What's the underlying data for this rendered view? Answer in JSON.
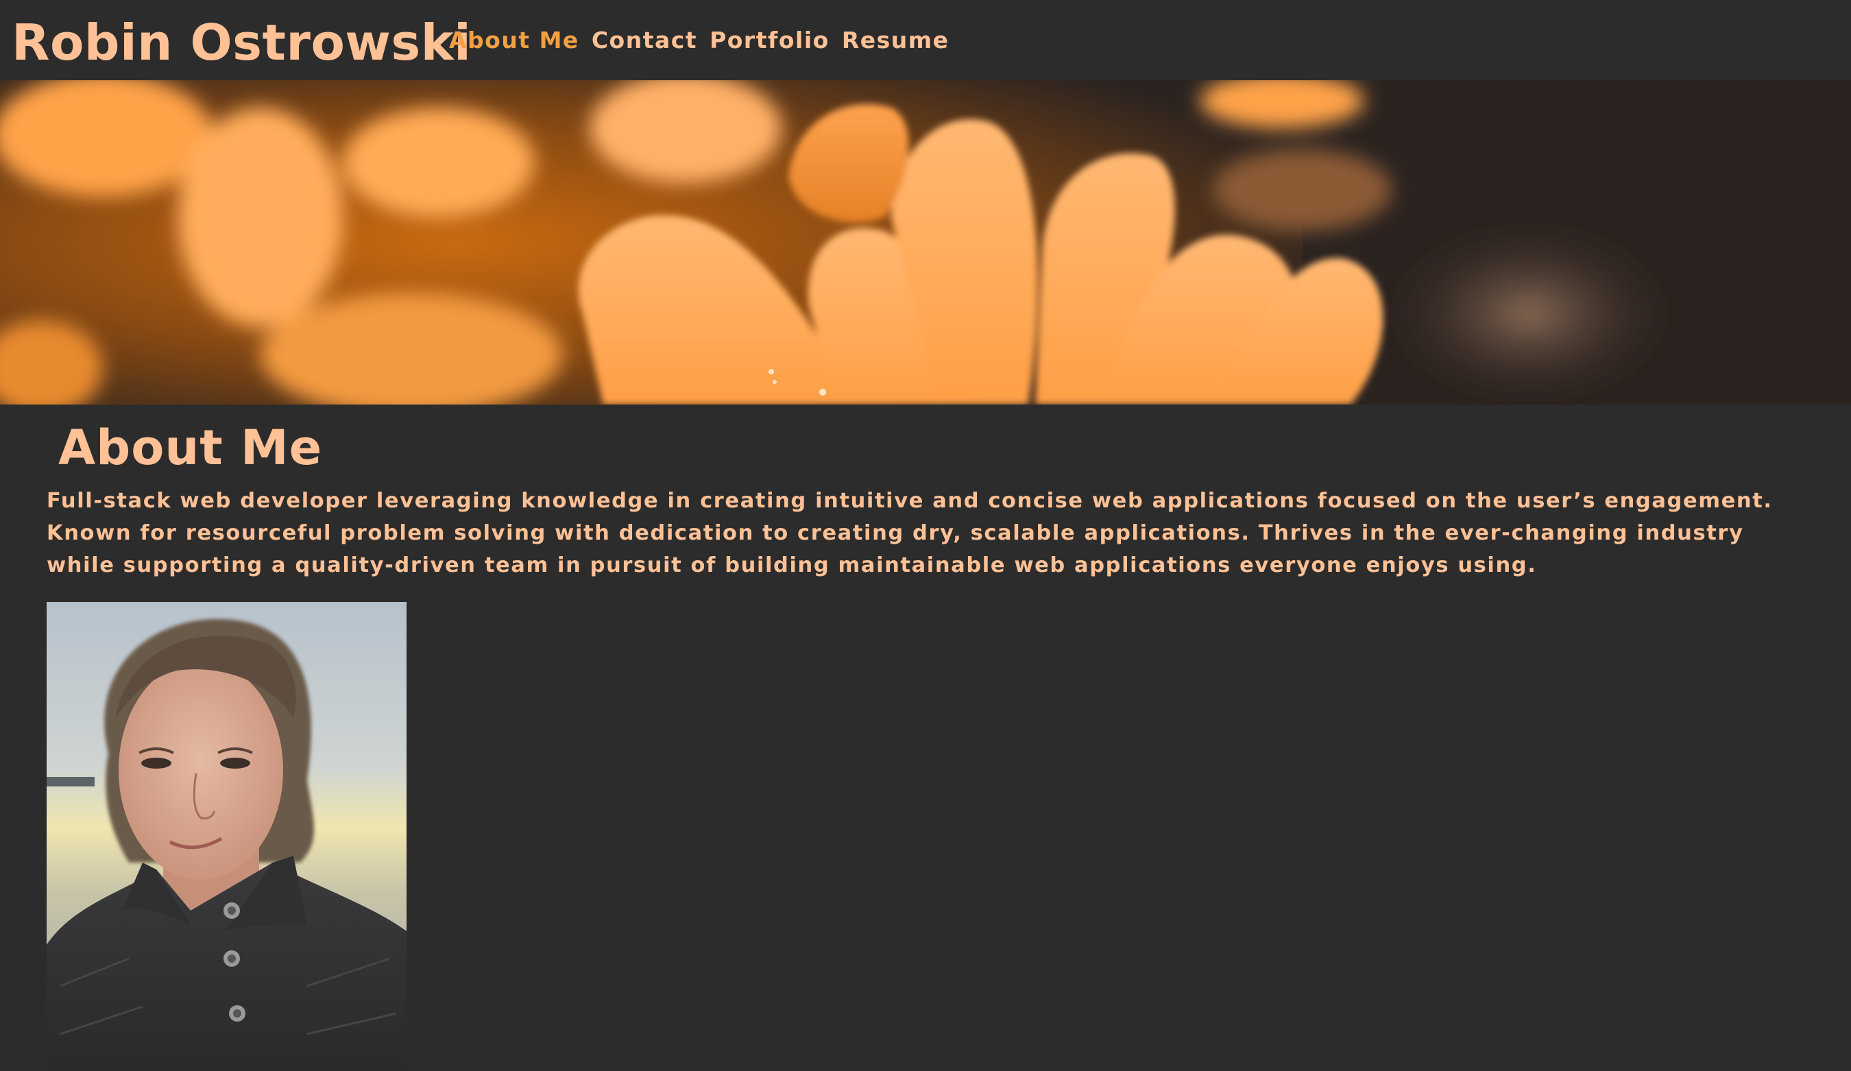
{
  "site": {
    "name": "Robin Ostrowski"
  },
  "nav": {
    "items": [
      {
        "label": "About Me",
        "active": true
      },
      {
        "label": "Contact",
        "active": false
      },
      {
        "label": "Portfolio",
        "active": false
      },
      {
        "label": "Resume",
        "active": false
      }
    ]
  },
  "hero": {
    "image": "orange-flower-petals-banner"
  },
  "about": {
    "title": "About Me",
    "text": "Full-stack web developer leveraging knowledge in creating intuitive and concise web applications focused on the user’s engagement. Known for resourceful problem solving with dedication to creating dry, scalable applications. Thrives in the ever-changing industry while supporting a quality-driven team in pursuit of building maintainable web applications everyone enjoys using.",
    "portrait": "profile-photo"
  },
  "colors": {
    "background": "#2c2c2c",
    "text": "#ffc195",
    "active_nav": "#f2a044"
  }
}
